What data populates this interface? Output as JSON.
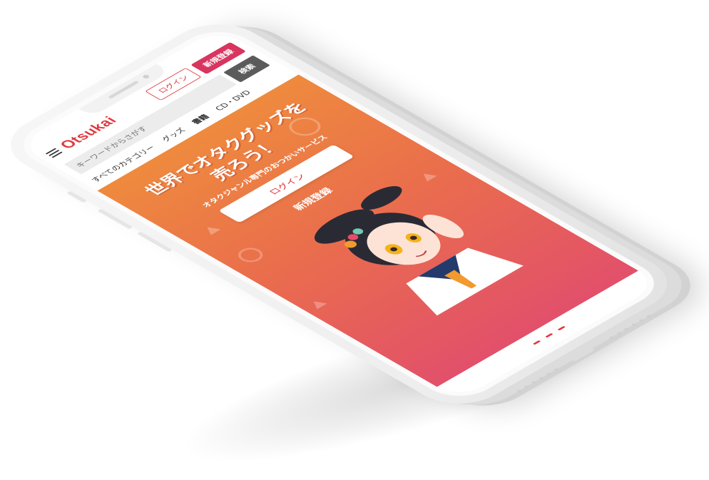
{
  "app": {
    "logo_text": "Otsukai",
    "brand_color": "#e0383e",
    "register_color": "#d8355f"
  },
  "header": {
    "menu_icon": "hamburger-icon",
    "login_label": "ログイン",
    "register_label": "新規登録"
  },
  "search": {
    "placeholder": "キーワードからさがす",
    "button_label": "検索"
  },
  "categories": [
    {
      "label": "すべてのカテゴリー"
    },
    {
      "label": "グッズ"
    },
    {
      "label": "書籍"
    },
    {
      "label": "CD・DVD"
    }
  ],
  "hero": {
    "title_line1": "世界でオタクグッズを",
    "title_line2": "売ろう！",
    "subtitle": "オタクジャンル専門のおつかいサービス",
    "login_label": "ログイン",
    "register_label": "新規登録",
    "gradient_top": "#ee8a3e",
    "gradient_bottom": "#e2506a"
  }
}
